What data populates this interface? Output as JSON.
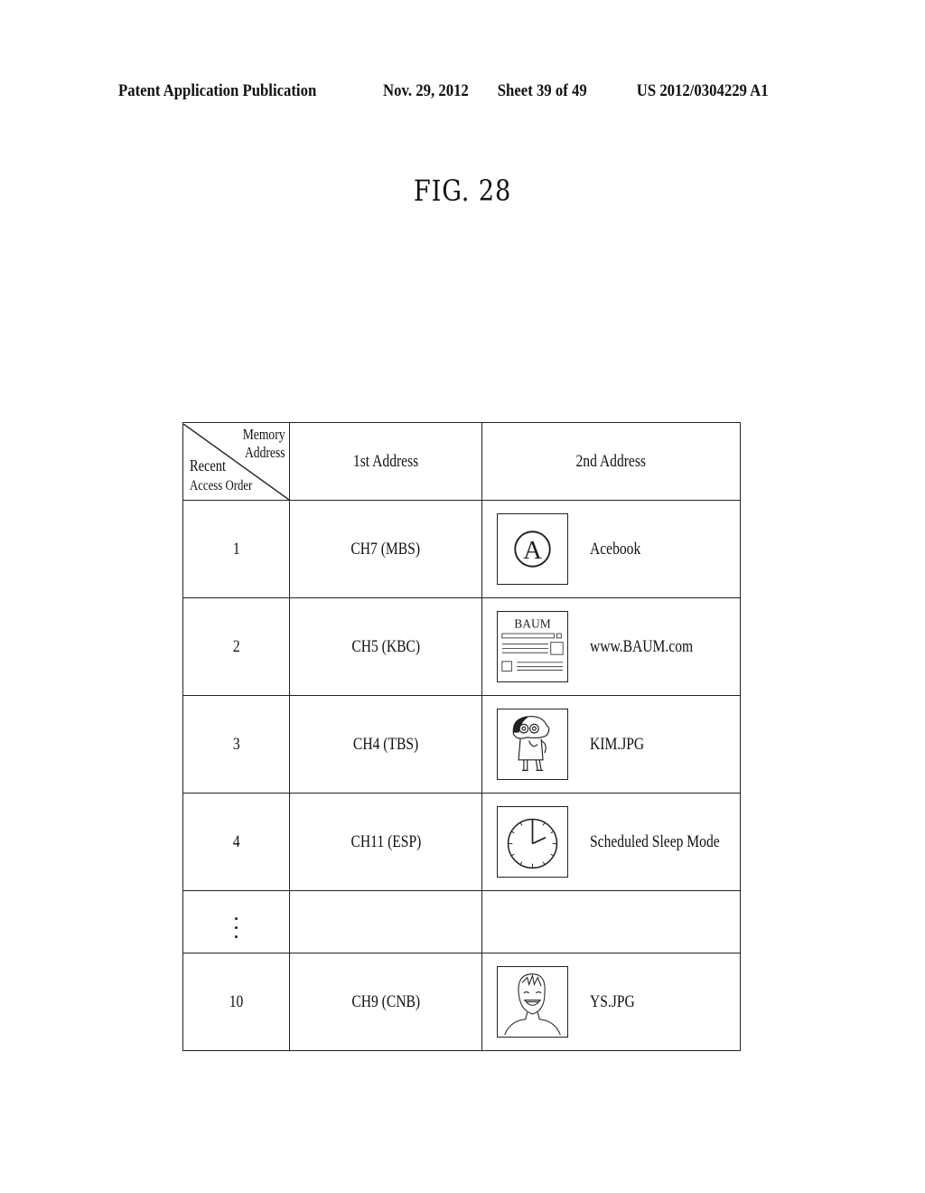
{
  "header": {
    "publication": "Patent Application Publication",
    "date": "Nov. 29, 2012",
    "sheet": "Sheet 39 of 49",
    "number": "US 2012/0304229 A1"
  },
  "figure": {
    "title": "FIG. 28"
  },
  "table": {
    "corner": {
      "top_right_line1": "Memory",
      "top_right_line2": "Address",
      "bottom_left_line1": "Recent",
      "bottom_left_line2": "Access Order"
    },
    "columns": [
      "1st Address",
      "2nd Address"
    ],
    "rows": [
      {
        "order": "1",
        "first": "CH7 (MBS)",
        "second": "Acebook",
        "icon": "letter-a-circle-icon"
      },
      {
        "order": "2",
        "first": "CH5 (KBC)",
        "second": "www.BAUM.com",
        "icon": "webpage-icon",
        "icon_text": "BAUM"
      },
      {
        "order": "3",
        "first": "CH4 (TBS)",
        "second": "KIM.JPG",
        "icon": "cartoon-character-icon"
      },
      {
        "order": "4",
        "first": "CH11 (ESP)",
        "second": "Scheduled Sleep Mode",
        "icon": "clock-icon"
      },
      {
        "order": "⋮",
        "first": "",
        "second": "",
        "icon": ""
      },
      {
        "order": "10",
        "first": "CH9 (CNB)",
        "second": "YS.JPG",
        "icon": "person-photo-icon"
      }
    ]
  }
}
